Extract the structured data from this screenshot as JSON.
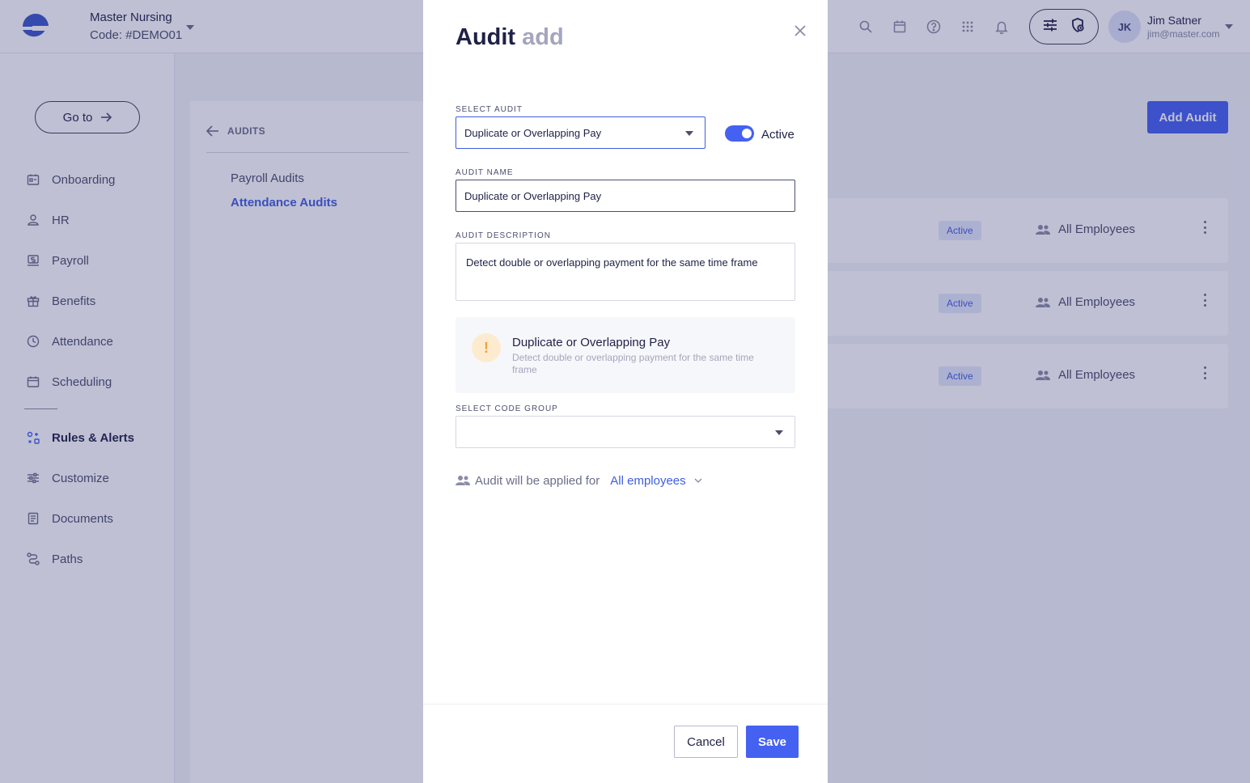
{
  "header": {
    "company_name": "Master Nursing",
    "company_code": "Code: #DEMO01",
    "icons": [
      "search-icon",
      "calendar-icon",
      "help-icon",
      "apps-grid-icon",
      "bell-icon",
      "sliders-icon",
      "shield-clock-icon"
    ],
    "user": {
      "initials": "JK",
      "name": "Jim Satner",
      "email": "jim@master.com"
    }
  },
  "sidebar": {
    "goto_label": "Go to",
    "items": [
      {
        "label": "Onboarding",
        "icon": "onboarding-icon"
      },
      {
        "label": "HR",
        "icon": "hr-icon"
      },
      {
        "label": "Payroll",
        "icon": "payroll-icon"
      },
      {
        "label": "Benefits",
        "icon": "gift-icon"
      },
      {
        "label": "Attendance",
        "icon": "clock-icon"
      },
      {
        "label": "Scheduling",
        "icon": "calendar-icon"
      },
      {
        "label": "Rules & Alerts",
        "icon": "rules-icon",
        "active": true
      },
      {
        "label": "Customize",
        "icon": "sliders-icon"
      },
      {
        "label": "Documents",
        "icon": "document-icon"
      },
      {
        "label": "Paths",
        "icon": "path-icon"
      }
    ]
  },
  "subnav": {
    "back_label": "AUDITS",
    "links": [
      "Payroll Audits",
      "Attendance Audits"
    ],
    "active_link": "Attendance Audits"
  },
  "main": {
    "add_audit_label": "Add Audit",
    "rows": [
      {
        "status": "Active",
        "applies_to": "All Employees"
      },
      {
        "status": "Active",
        "applies_to": "All Employees"
      },
      {
        "status": "Active",
        "applies_to": "All Employees"
      }
    ]
  },
  "modal": {
    "title": "Audit",
    "title_suffix": "add",
    "select_audit_label": "SELECT AUDIT",
    "select_audit_value": "Duplicate or Overlapping Pay",
    "active_label": "Active",
    "active_on": true,
    "audit_name_label": "AUDIT NAME",
    "audit_name_value": "Duplicate or Overlapping Pay",
    "audit_description_label": "AUDIT DESCRIPTION",
    "audit_description_value": "Detect double or overlapping payment for the same time frame",
    "info_card": {
      "icon_glyph": "!",
      "title": "Duplicate or Overlapping Pay",
      "description": "Detect double or overlapping payment for the same time frame"
    },
    "code_group_label": "SELECT CODE GROUP",
    "code_group_value": "",
    "applied_text": "Audit will be applied for",
    "applied_link": "All employees",
    "cancel_label": "Cancel",
    "save_label": "Save"
  },
  "colors": {
    "accent": "#4461f2",
    "overlay": "#2a2e6e",
    "warning": "#f0a23a"
  }
}
